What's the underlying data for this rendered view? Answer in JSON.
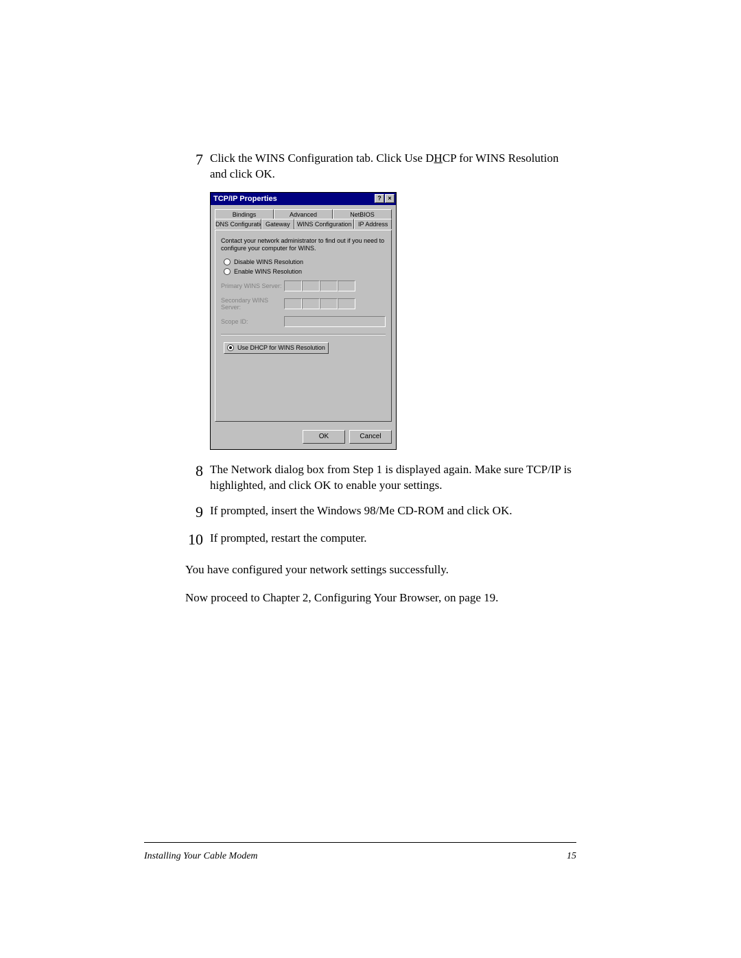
{
  "steps": {
    "s7": {
      "num": "7",
      "text_a": "Click the WINS Configuration tab. Click Use D",
      "text_h": "H",
      "text_b": "CP for WINS Resolution and click OK."
    },
    "s8": {
      "num": "8",
      "text": "The Network dialog box from Step 1 is displayed again. Make sure TCP/IP is highlighted, and click OK to enable your settings."
    },
    "s9": {
      "num": "9",
      "text": "If prompted, insert the Windows 98/Me CD-ROM and click OK."
    },
    "s10": {
      "num": "10",
      "text": "If prompted, restart the computer."
    }
  },
  "dialog": {
    "title": "TCP/IP Properties",
    "help_btn": "?",
    "close_btn": "×",
    "tabs_back": [
      "Bindings",
      "Advanced",
      "NetBIOS"
    ],
    "tabs_front": [
      "DNS Configuration",
      "Gateway",
      "WINS Configuration",
      "IP Address"
    ],
    "active_tab_index": 2,
    "panel_msg": "Contact your network administrator to find out if you need to configure your computer for WINS.",
    "radio_disable": "Disable WINS Resolution",
    "radio_enable": "Enable WINS Resolution",
    "primary_label": "Primary WINS Server:",
    "secondary_label": "Secondary WINS Server:",
    "scope_label": "Scope ID:",
    "radio_dhcp": "Use DHCP for WINS Resolution",
    "ok": "OK",
    "cancel": "Cancel"
  },
  "closing": {
    "p1": "You have configured your network settings successfully.",
    "p2": "Now proceed to Chapter 2, Configuring Your Browser, on page 19."
  },
  "footer": {
    "left": "Installing Your Cable Modem",
    "right": "15"
  }
}
